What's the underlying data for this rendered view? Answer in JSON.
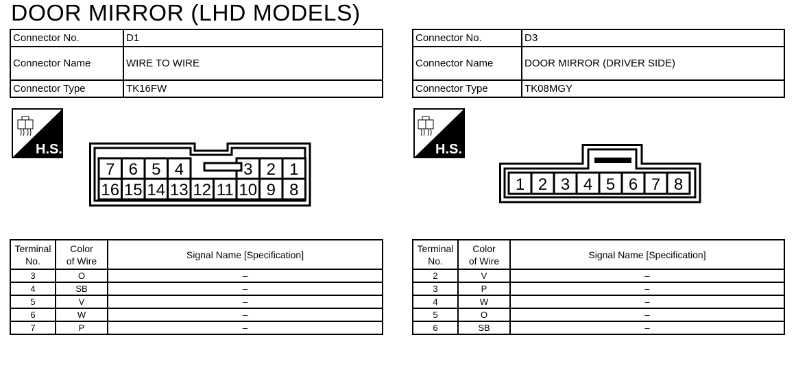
{
  "page_title": "DOOR MIRROR (LHD MODELS)",
  "labels": {
    "connector_no": "Connector No.",
    "connector_name": "Connector Name",
    "connector_type": "Connector Type",
    "hs_badge": "H.S."
  },
  "table_headers": {
    "terminal_line1": "Terminal",
    "terminal_line2": "No.",
    "color_line1": "Color",
    "color_line2": "of Wire",
    "signal": "Signal Name [Specification]"
  },
  "connectors": [
    {
      "connector_no": "D1",
      "connector_name": "WIRE TO WIRE",
      "connector_type": "TK16FW",
      "hs_icon": "harness-side-icon",
      "pin_top_row": [
        "7",
        "6",
        "5",
        "4",
        "3",
        "2",
        "1"
      ],
      "pin_bottom_row": [
        "16",
        "15",
        "14",
        "13",
        "12",
        "11",
        "10",
        "9",
        "8"
      ],
      "terminals": [
        {
          "no": "3",
          "color": "O",
          "signal": "–"
        },
        {
          "no": "4",
          "color": "SB",
          "signal": "–"
        },
        {
          "no": "5",
          "color": "V",
          "signal": "–"
        },
        {
          "no": "6",
          "color": "W",
          "signal": "–"
        },
        {
          "no": "7",
          "color": "P",
          "signal": "–"
        }
      ]
    },
    {
      "connector_no": "D3",
      "connector_name": "DOOR MIRROR (DRIVER SIDE)",
      "connector_type": "TK08MGY",
      "hs_icon": "harness-side-icon",
      "pin_row": [
        "1",
        "2",
        "3",
        "4",
        "5",
        "6",
        "7",
        "8"
      ],
      "terminals": [
        {
          "no": "2",
          "color": "V",
          "signal": "–"
        },
        {
          "no": "3",
          "color": "P",
          "signal": "–"
        },
        {
          "no": "4",
          "color": "W",
          "signal": "–"
        },
        {
          "no": "5",
          "color": "O",
          "signal": "–"
        },
        {
          "no": "6",
          "color": "SB",
          "signal": "–"
        }
      ]
    }
  ]
}
